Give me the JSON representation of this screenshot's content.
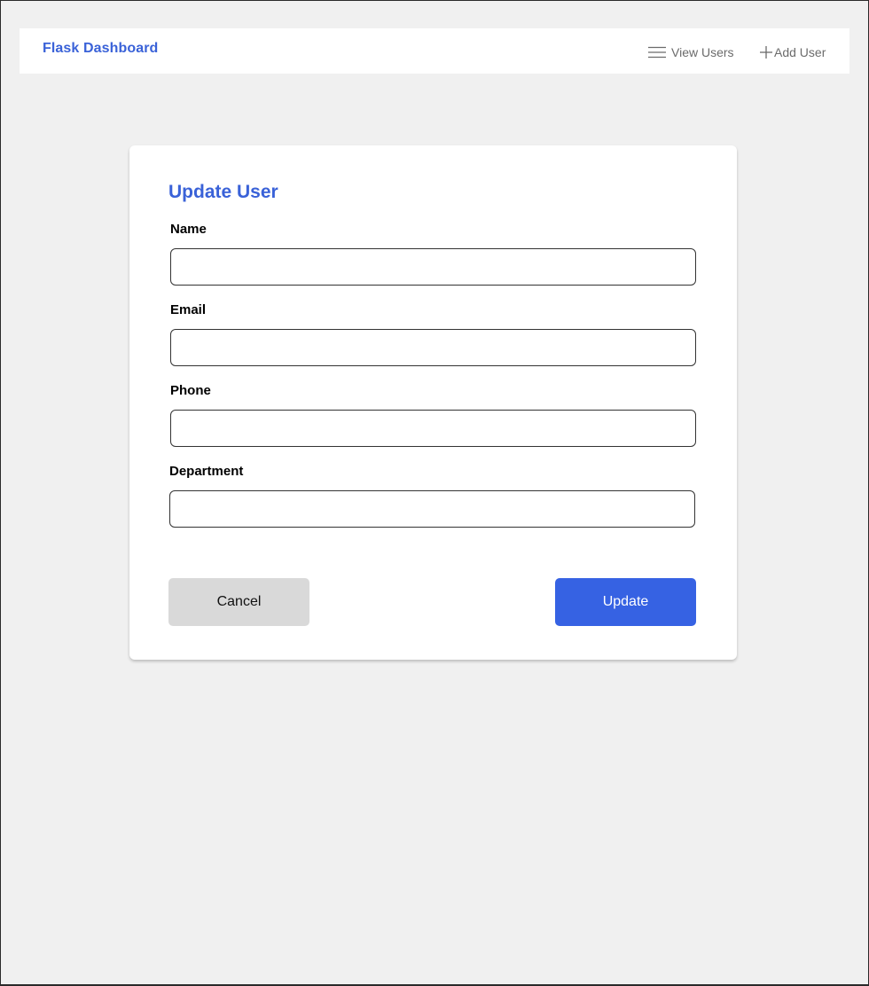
{
  "navbar": {
    "brand": "Flask Dashboard",
    "links": [
      {
        "label": "View Users",
        "icon": "menu-icon"
      },
      {
        "label": "Add User",
        "icon": "plus-icon"
      }
    ]
  },
  "form": {
    "title": "Update User",
    "fields": [
      {
        "label": "Name",
        "value": "",
        "placeholder": ""
      },
      {
        "label": "Email",
        "value": "",
        "placeholder": ""
      },
      {
        "label": "Phone",
        "value": "",
        "placeholder": ""
      },
      {
        "label": "Department",
        "value": "",
        "placeholder": ""
      }
    ],
    "cancel_label": "Cancel",
    "update_label": "Update"
  },
  "colors": {
    "accent": "#3a62d8",
    "primary_button": "#3662e3",
    "secondary_button": "#d9d9d9",
    "background": "#f0f0f0"
  }
}
